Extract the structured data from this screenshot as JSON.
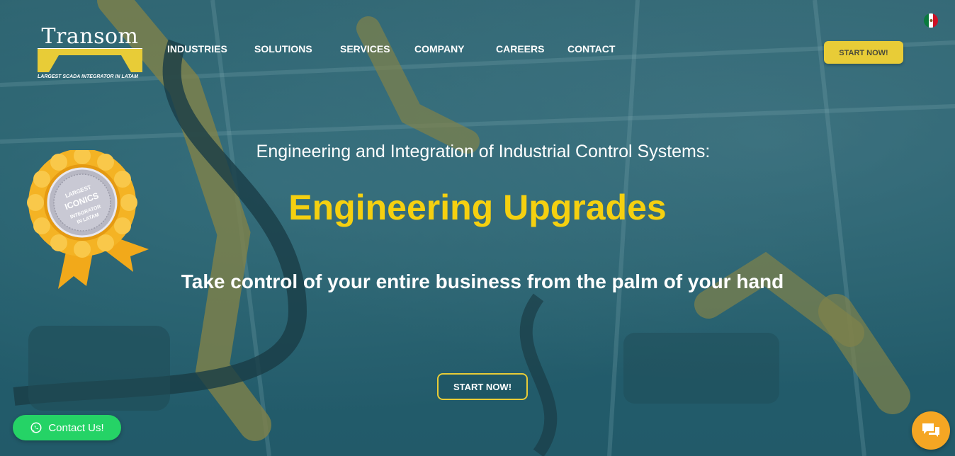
{
  "brand": {
    "name": "Transom",
    "tagline": "LARGEST SCADA INTEGRATOR IN LATAM"
  },
  "nav": {
    "items": [
      "INDUSTRIES",
      "SOLUTIONS",
      "SERVICES",
      "COMPANY",
      "CAREERS",
      "CONTACT"
    ]
  },
  "header": {
    "cta_label": "START NOW!",
    "language_flag": "mexico-flag-icon"
  },
  "hero": {
    "subtitle": "Engineering and Integration of Industrial Control Systems:",
    "headline": "Engineering Upgrades",
    "tagline": "Take control of your entire business from the palm of your hand",
    "cta_label": "START NOW!"
  },
  "badge": {
    "ribbon_text": "LARGEST ICONICS INTEGRATOR IN LATAM",
    "icon": "award-rosette-icon"
  },
  "widgets": {
    "whatsapp_label": "Contact Us!",
    "whatsapp_icon": "whatsapp-icon",
    "chat_icon": "chat-icon"
  },
  "colors": {
    "accent_yellow": "#f5d010",
    "button_yellow": "#e8cc37",
    "whatsapp_green": "#25d366",
    "chat_orange": "#f5a623",
    "overlay_teal": "#2b5f6a"
  }
}
